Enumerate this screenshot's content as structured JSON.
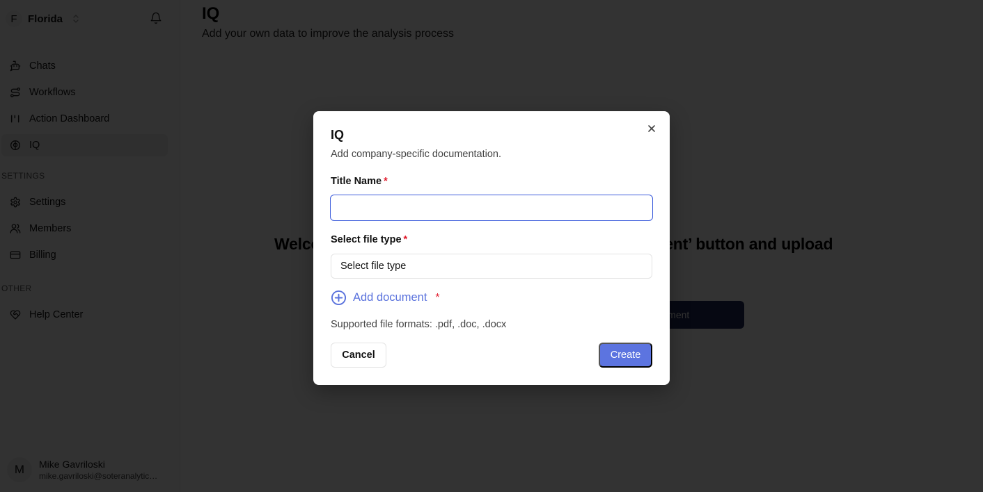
{
  "sidebar": {
    "org": {
      "initial": "F",
      "name": "Florida"
    },
    "nav_items": [
      {
        "label": "Chats",
        "icon": "bot-icon"
      },
      {
        "label": "Workflows",
        "icon": "workflow-icon"
      },
      {
        "label": "Action Dashboard",
        "icon": "dashboard-icon"
      },
      {
        "label": "IQ",
        "icon": "brain-icon",
        "active": true
      }
    ],
    "settings_section": "SETTINGS",
    "settings_items": [
      {
        "label": "Settings",
        "icon": "gear-icon"
      },
      {
        "label": "Members",
        "icon": "users-icon"
      },
      {
        "label": "Billing",
        "icon": "credit-card-icon"
      }
    ],
    "other_section": "OTHER",
    "other_items": [
      {
        "label": "Help Center",
        "icon": "heart-handshake-icon"
      }
    ],
    "user": {
      "initial": "M",
      "name": "Mike Gavriloski",
      "email": "mike.gavriloski@soteranalytics.com"
    }
  },
  "main": {
    "title": "IQ",
    "subtitle": "Add your own data to improve the analysis process",
    "welcome_text": "Welcome to IQ! To get started, click the ‘Add Document’ button and upload",
    "cta_label": "Add Document"
  },
  "modal": {
    "title": "IQ",
    "description": "Add company-specific documentation.",
    "title_field": {
      "label": "Title Name",
      "required_mark": "*",
      "value": "",
      "placeholder": ""
    },
    "file_type_field": {
      "label": "Select file type",
      "required_mark": "*",
      "placeholder": "Select file type"
    },
    "add_document": {
      "label": "Add document",
      "required_mark": "*"
    },
    "supported_formats": "Supported file formats: .pdf, .doc, .docx",
    "cancel_label": "Cancel",
    "create_label": "Create"
  },
  "colors": {
    "accent": "#5c74e0",
    "focus_border": "#3b5bdb",
    "required": "#e11d2e",
    "cta_bg": "#1e2a5a"
  }
}
